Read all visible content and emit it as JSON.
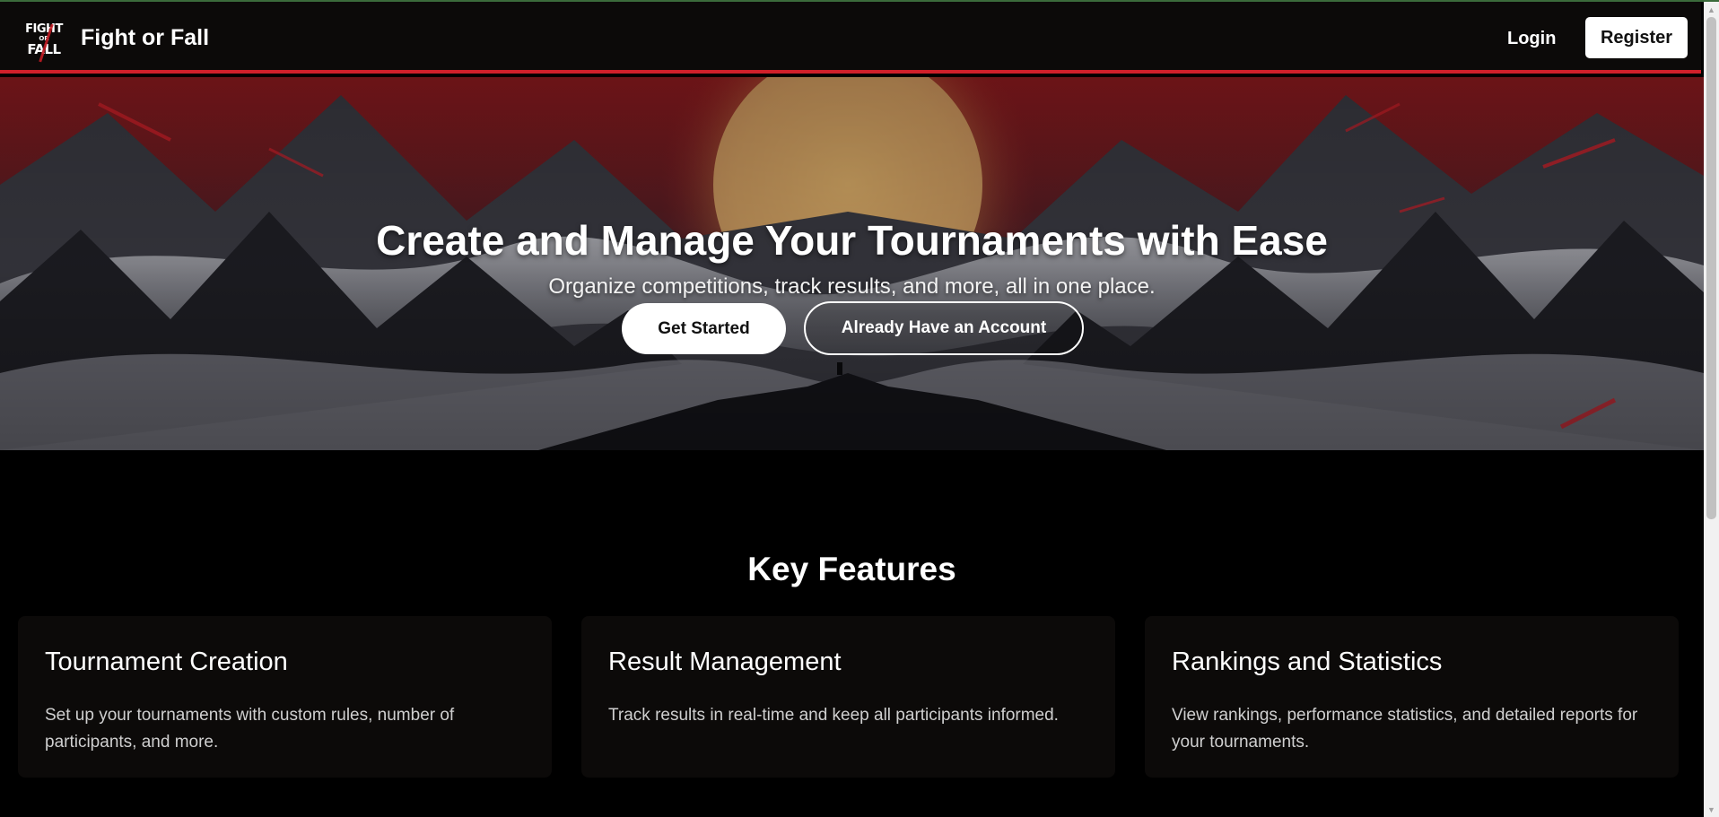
{
  "app": {
    "brand": "Fight or Fall",
    "logo_text": [
      "FIGHT",
      "OR",
      "FALL"
    ]
  },
  "nav": {
    "login": "Login",
    "register": "Register"
  },
  "hero": {
    "title": "Create and Manage Your Tournaments with Ease",
    "subtitle": "Organize competitions, track results, and more, all in one place.",
    "primary_button": "Get Started",
    "secondary_button": "Already Have an Account"
  },
  "features": {
    "title": "Key Features",
    "cards": [
      {
        "title": "Tournament Creation",
        "text": "Set up your tournaments with custom rules, number of participants, and more."
      },
      {
        "title": "Result Management",
        "text": "Track results in real-time and keep all participants informed."
      },
      {
        "title": "Rankings and Statistics",
        "text": "View rankings, performance statistics, and detailed reports for your tournaments."
      }
    ]
  },
  "colors": {
    "accent": "#d0202a",
    "navbar_bg": "#0c0a09",
    "card_bg": "#0c0a09",
    "page_bg": "#000000"
  }
}
